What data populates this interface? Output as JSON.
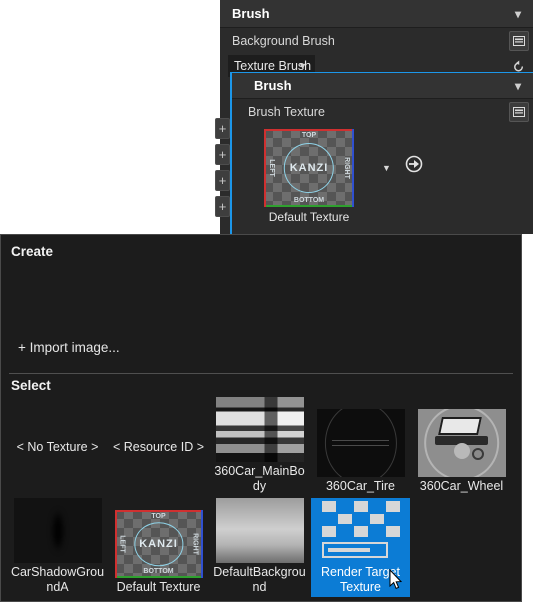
{
  "properties_panel": {
    "title": "Brush",
    "collapse_icon": "chevron-down-icon",
    "rows": [
      {
        "label": "Background Brush",
        "icon": "property-editor-icon"
      }
    ],
    "combo": {
      "value": "Texture Brush",
      "caret_icon": "caret-down-icon",
      "reset_icon": "reset-arrow-icon"
    },
    "plus_buttons": [
      "+",
      "+",
      "+",
      "+"
    ]
  },
  "nested_brush": {
    "title": "Brush",
    "collapse_icon": "chevron-down-icon",
    "row_label": "Brush Texture",
    "row_icon": "property-editor-icon",
    "texture": {
      "name": "Default Texture",
      "caret_icon": "caret-down-icon",
      "goto_icon": "go-to-icon",
      "thumb_words": {
        "top": "TOP",
        "bottom": "BOTTOM",
        "left": "LEFT",
        "right": "RIGHT",
        "center": "KANZI"
      }
    }
  },
  "picker": {
    "create_header": "Create",
    "import_label": "+ Import image...",
    "select_header": "Select",
    "items": [
      {
        "caption": "< No Texture >",
        "thumb": "none",
        "selected": false
      },
      {
        "caption": "< Resource ID >",
        "thumb": "none",
        "selected": false
      },
      {
        "caption": "360Car_MainBody",
        "thumb": "mainbody",
        "selected": false
      },
      {
        "caption": "360Car_Tire",
        "thumb": "tire",
        "selected": false
      },
      {
        "caption": "360Car_Wheel",
        "thumb": "wheel",
        "selected": false
      },
      {
        "caption": "CarShadowGroundA",
        "thumb": "shadow",
        "selected": false
      },
      {
        "caption": "Default Texture",
        "thumb": "kanzi",
        "selected": false
      },
      {
        "caption": "DefaultBackground",
        "thumb": "background",
        "selected": false
      },
      {
        "caption": "Render Target Texture",
        "thumb": "render-target",
        "selected": true
      }
    ]
  },
  "colors": {
    "accent": "#0c7cd5",
    "focus_border": "#1c97ea",
    "panel_bg": "#2b2b2b",
    "popup_bg": "#1c1c1c",
    "text": "#e8e8e8"
  },
  "cursor": {
    "icon": "mouse-pointer-icon"
  }
}
